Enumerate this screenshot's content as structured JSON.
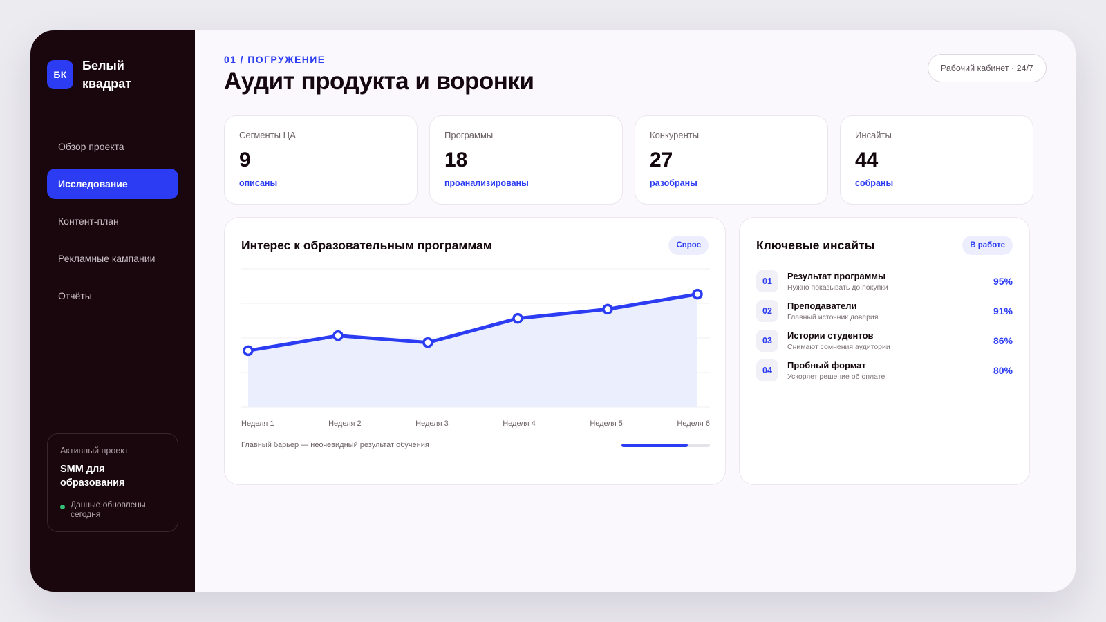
{
  "brand": {
    "logo_text": "БК",
    "name": "Белый квадрат"
  },
  "sidebar": {
    "items": [
      {
        "label": "Обзор проекта",
        "active": false
      },
      {
        "label": "Исследование",
        "active": true
      },
      {
        "label": "Контент-план",
        "active": false
      },
      {
        "label": "Рекламные кампании",
        "active": false
      },
      {
        "label": "Отчёты",
        "active": false
      }
    ],
    "project": {
      "caption": "Активный проект",
      "name": "SMM для образования",
      "status": "Данные обновлены сегодня"
    }
  },
  "header": {
    "eyebrow": "01 / ПОГРУЖЕНИЕ",
    "title": "Аудит продукта и воронки",
    "workspace": "Рабочий кабинет · 24/7"
  },
  "stats": [
    {
      "label": "Сегменты ЦА",
      "value": "9",
      "note": "описаны"
    },
    {
      "label": "Программы",
      "value": "18",
      "note": "проанализированы"
    },
    {
      "label": "Конкуренты",
      "value": "27",
      "note": "разобраны"
    },
    {
      "label": "Инсайты",
      "value": "44",
      "note": "собраны"
    }
  ],
  "chart_panel": {
    "title": "Интерес к образовательным программам",
    "badge": "Спрос",
    "footer_note": "Главный барьер — неочевидный результат обучения",
    "progress": 0.75
  },
  "chart_data": {
    "type": "area",
    "categories": [
      "Неделя 1",
      "Неделя 2",
      "Неделя 3",
      "Неделя 4",
      "Неделя 5",
      "Неделя 6"
    ],
    "series": [
      {
        "values": [
          49,
          62,
          56,
          77,
          85,
          98
        ]
      }
    ],
    "ylim": [
      0,
      120
    ],
    "grid": true,
    "color": "#2b3cf2",
    "fill_color": "#ebeffd"
  },
  "insights_panel": {
    "title": "Ключевые инсайты",
    "badge": "В работе",
    "items": [
      {
        "num": "01",
        "title": "Результат программы",
        "sub": "Нужно показывать до покупки",
        "pct": "95%"
      },
      {
        "num": "02",
        "title": "Преподаватели",
        "sub": "Главный источник доверия",
        "pct": "91%"
      },
      {
        "num": "03",
        "title": "Истории студентов",
        "sub": "Снимают сомнения аудитории",
        "pct": "86%"
      },
      {
        "num": "04",
        "title": "Пробный формат",
        "sub": "Ускоряет решение об оплате",
        "pct": "80%"
      }
    ]
  }
}
